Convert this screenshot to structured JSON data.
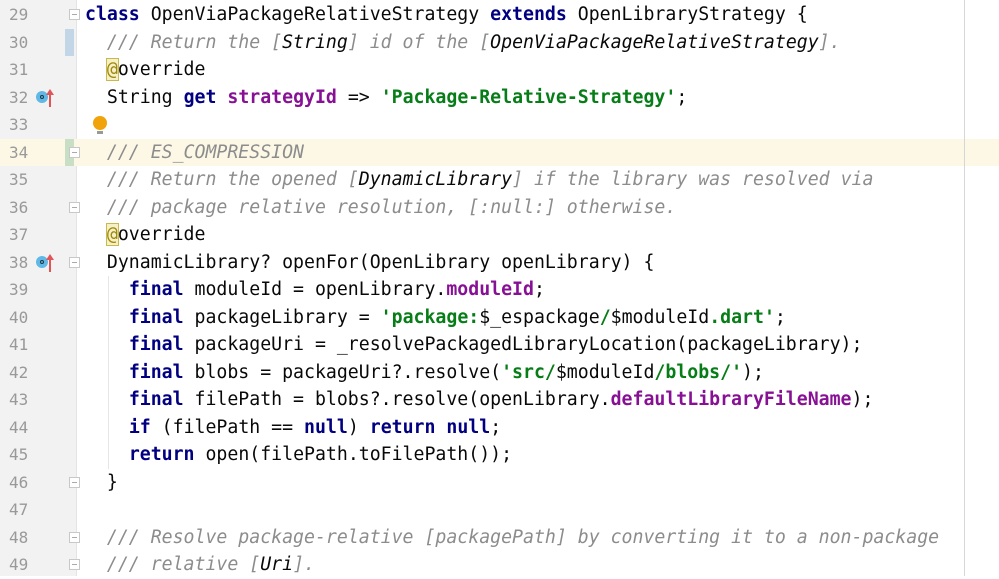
{
  "editor": {
    "current_line": 34,
    "colors": {
      "keyword": "#000080",
      "string": "#067d17",
      "comment": "#8c8c8c",
      "field": "#871094",
      "current_line": "#fdf8e6",
      "vcs_modified": "#c3d6e8",
      "vcs_added": "#c9dfc5"
    },
    "vcs_markers": [
      {
        "line": 30,
        "type": "modified"
      },
      {
        "line": 34,
        "type": "added"
      }
    ],
    "override_icons": [
      32,
      38
    ],
    "fold_markers": [
      29,
      34,
      36,
      38,
      46,
      48,
      49
    ],
    "intention_bulb_line": 33,
    "lines": [
      {
        "num": "29",
        "tokens": [
          [
            "kw",
            "class"
          ],
          [
            "p",
            " OpenViaPackageRelativeStrategy "
          ],
          [
            "kw",
            "extends"
          ],
          [
            "p",
            " OpenLibraryStrategy {"
          ]
        ]
      },
      {
        "num": "30",
        "tokens": [
          [
            "p",
            "  "
          ],
          [
            "cm",
            "/// Return the ["
          ],
          [
            "ref",
            "String"
          ],
          [
            "cm",
            "] id of the ["
          ],
          [
            "ref",
            "OpenViaPackageRelativeStrategy"
          ],
          [
            "cm",
            "]."
          ]
        ]
      },
      {
        "num": "31",
        "tokens": [
          [
            "p",
            "  "
          ],
          [
            "ann",
            "@"
          ],
          [
            "p",
            "override"
          ]
        ]
      },
      {
        "num": "32",
        "tokens": [
          [
            "p",
            "  String "
          ],
          [
            "kw",
            "get"
          ],
          [
            "p",
            " "
          ],
          [
            "fld",
            "strategyId"
          ],
          [
            "p",
            " => "
          ],
          [
            "str",
            "'Package-Relative-Strategy'"
          ],
          [
            "p",
            ";"
          ]
        ]
      },
      {
        "num": "33",
        "tokens": []
      },
      {
        "num": "34",
        "tokens": [
          [
            "p",
            "  "
          ],
          [
            "cm",
            "/// ES_COMPRESSION"
          ]
        ]
      },
      {
        "num": "35",
        "tokens": [
          [
            "p",
            "  "
          ],
          [
            "cm",
            "/// Return the opened ["
          ],
          [
            "ref",
            "DynamicLibrary"
          ],
          [
            "cm",
            "] if the library was resolved via"
          ]
        ]
      },
      {
        "num": "36",
        "tokens": [
          [
            "p",
            "  "
          ],
          [
            "cm",
            "/// package relative resolution, [:null:] otherwise."
          ]
        ]
      },
      {
        "num": "37",
        "tokens": [
          [
            "p",
            "  "
          ],
          [
            "ann",
            "@"
          ],
          [
            "p",
            "override"
          ]
        ]
      },
      {
        "num": "38",
        "tokens": [
          [
            "p",
            "  DynamicLibrary? openFor(OpenLibrary openLibrary) {"
          ]
        ]
      },
      {
        "num": "39",
        "tokens": [
          [
            "p",
            "    "
          ],
          [
            "kw",
            "final"
          ],
          [
            "p",
            " moduleId = openLibrary."
          ],
          [
            "fld",
            "moduleId"
          ],
          [
            "p",
            ";"
          ]
        ]
      },
      {
        "num": "40",
        "tokens": [
          [
            "p",
            "    "
          ],
          [
            "kw",
            "final"
          ],
          [
            "p",
            " packageLibrary = "
          ],
          [
            "str",
            "'package:"
          ],
          [
            "p",
            "$_espackage"
          ],
          [
            "str",
            "/"
          ],
          [
            "p",
            "$moduleId"
          ],
          [
            "str",
            ".dart'"
          ],
          [
            "p",
            ";"
          ]
        ]
      },
      {
        "num": "41",
        "tokens": [
          [
            "p",
            "    "
          ],
          [
            "kw",
            "final"
          ],
          [
            "p",
            " packageUri = _resolvePackagedLibraryLocation(packageLibrary);"
          ]
        ]
      },
      {
        "num": "42",
        "tokens": [
          [
            "p",
            "    "
          ],
          [
            "kw",
            "final"
          ],
          [
            "p",
            " blobs = packageUri?.resolve("
          ],
          [
            "str",
            "'src/"
          ],
          [
            "p",
            "$moduleId"
          ],
          [
            "str",
            "/blobs/'"
          ],
          [
            "p",
            ");"
          ]
        ]
      },
      {
        "num": "43",
        "tokens": [
          [
            "p",
            "    "
          ],
          [
            "kw",
            "final"
          ],
          [
            "p",
            " filePath = blobs?.resolve(openLibrary."
          ],
          [
            "fld",
            "defaultLibraryFileName"
          ],
          [
            "p",
            ");"
          ]
        ]
      },
      {
        "num": "44",
        "tokens": [
          [
            "p",
            "    "
          ],
          [
            "kw",
            "if"
          ],
          [
            "p",
            " (filePath == "
          ],
          [
            "kw",
            "null"
          ],
          [
            "p",
            ") "
          ],
          [
            "kw",
            "return"
          ],
          [
            "p",
            " "
          ],
          [
            "kw",
            "null"
          ],
          [
            "p",
            ";"
          ]
        ]
      },
      {
        "num": "45",
        "tokens": [
          [
            "p",
            "    "
          ],
          [
            "kw",
            "return"
          ],
          [
            "p",
            " open(filePath.toFilePath());"
          ]
        ]
      },
      {
        "num": "46",
        "tokens": [
          [
            "p",
            "  }"
          ]
        ]
      },
      {
        "num": "47",
        "tokens": []
      },
      {
        "num": "48",
        "tokens": [
          [
            "p",
            "  "
          ],
          [
            "cm",
            "/// Resolve package-relative [packagePath] by converting it to a non-package"
          ]
        ]
      },
      {
        "num": "49",
        "tokens": [
          [
            "p",
            "  "
          ],
          [
            "cm",
            "/// relative ["
          ],
          [
            "ref",
            "Uri"
          ],
          [
            "cm",
            "]."
          ]
        ]
      }
    ]
  }
}
